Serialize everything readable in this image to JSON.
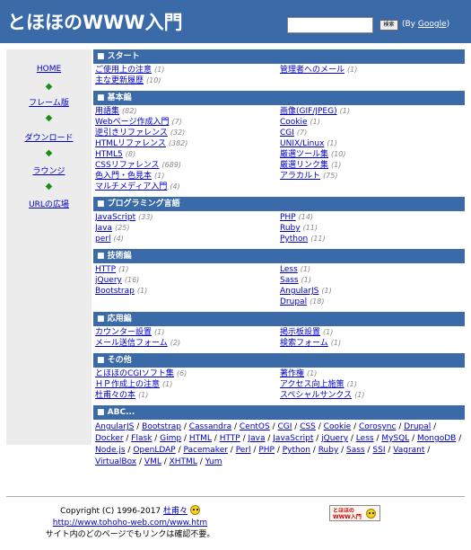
{
  "header": {
    "title": "とほほのWWW入門",
    "search_button": "検索",
    "by_prefix": "(By ",
    "by_link": "Google",
    "by_suffix": ")"
  },
  "sidebar": {
    "items": [
      "HOME",
      "フレーム版",
      "ダウンロード",
      "ラウンジ",
      "URLの広場"
    ]
  },
  "sections": [
    {
      "title": "■ スタート",
      "left": [
        {
          "label": "ご使用上の注意",
          "count": "(1)"
        },
        {
          "label": "主な更新履歴",
          "count": "(10)"
        }
      ],
      "right": [
        {
          "label": "管理者へのメール",
          "count": "(1)"
        }
      ]
    },
    {
      "title": "■ 基本編",
      "left": [
        {
          "label": "用語集",
          "count": "(82)"
        },
        {
          "label": "Webページ作成入門",
          "count": "(7)"
        },
        {
          "label": "逆引きリファレンス",
          "count": "(32)"
        },
        {
          "label": "HTMLリファレンス",
          "count": "(382)"
        },
        {
          "label": "HTML5",
          "count": "(8)"
        },
        {
          "label": "CSSリファレンス",
          "count": "(689)"
        },
        {
          "label": "色入門・色見本",
          "count": "(1)"
        },
        {
          "label": "マルチメディア入門",
          "count": "(4)"
        }
      ],
      "right": [
        {
          "label": "画像(GIF/JPEG)",
          "count": "(1)"
        },
        {
          "label": "Cookie",
          "count": "(1)"
        },
        {
          "label": "CGI",
          "count": "(7)"
        },
        {
          "label": "UNIX/Linux",
          "count": "(1)"
        },
        {
          "label": "厳選ツール集",
          "count": "(10)"
        },
        {
          "label": "厳選リンク集",
          "count": "(1)"
        },
        {
          "label": "アラカルト",
          "count": "(75)"
        }
      ]
    },
    {
      "title": "■ プログラミング言語",
      "left": [
        {
          "label": "JavaScript",
          "count": "(33)"
        },
        {
          "label": "Java",
          "count": "(25)"
        },
        {
          "label": "perl",
          "count": "(4)"
        }
      ],
      "right": [
        {
          "label": "PHP",
          "count": "(14)"
        },
        {
          "label": "Ruby",
          "count": "(11)"
        },
        {
          "label": "Python",
          "count": "(11)"
        }
      ]
    },
    {
      "title": "■ 技術編",
      "left": [
        {
          "label": "HTTP",
          "count": "(1)"
        },
        {
          "label": "jQuery",
          "count": "(16)"
        },
        {
          "label": "Bootstrap",
          "count": "(1)"
        }
      ],
      "right": [
        {
          "label": "Less",
          "count": "(1)"
        },
        {
          "label": "Sass",
          "count": "(1)"
        },
        {
          "label": "AngularJS",
          "count": "(1)"
        },
        {
          "label": "Drupal",
          "count": "(18)"
        }
      ]
    },
    {
      "title": "■ 応用編",
      "left": [
        {
          "label": "カウンター設置",
          "count": "(1)"
        },
        {
          "label": "メール送信フォーム",
          "count": "(2)"
        }
      ],
      "right": [
        {
          "label": "掲示板設置",
          "count": "(1)"
        },
        {
          "label": "検索フォーム",
          "count": "(1)"
        }
      ]
    },
    {
      "title": "■ その他",
      "left": [
        {
          "label": "とほほのCGIソフト集",
          "count": "(6)"
        },
        {
          "label": "ＨＰ作成上の注意",
          "count": "(1)"
        },
        {
          "label": "杜甫々の本",
          "count": "(1)"
        }
      ],
      "right": [
        {
          "label": "著作権",
          "count": "(1)"
        },
        {
          "label": "アクセス向上施策",
          "count": "(1)"
        },
        {
          "label": "スペシャルサンクス",
          "count": "(1)"
        }
      ]
    }
  ],
  "abc": {
    "title": "■ ABC...",
    "items": [
      "AngularJS",
      "Bootstrap",
      "Cassandra",
      "CentOS",
      "CGI",
      "CSS",
      "Cookie",
      "Corosync",
      "Drupal",
      "Docker",
      "Flask",
      "Gimp",
      "HTML",
      "HTTP",
      "Java",
      "JavaScript",
      "jQuery",
      "Less",
      "MySQL",
      "MongoDB",
      "Node.js",
      "OpenLDAP",
      "Pacemaker",
      "Perl",
      "PHP",
      "Python",
      "Ruby",
      "Sass",
      "SSI",
      "Vagrant",
      "VirtualBox",
      "VML",
      "XHTML",
      "Yum"
    ]
  },
  "footer": {
    "copyright": "Copyright (C) 1996-2017 ",
    "author": "杜甫々",
    "url": "http://www.tohoho-web.com/www.htm",
    "notice": "サイト内のどのページでもリンクは確認不要。",
    "logo_line1": "とほほの",
    "logo_line2": "WWW入門"
  }
}
